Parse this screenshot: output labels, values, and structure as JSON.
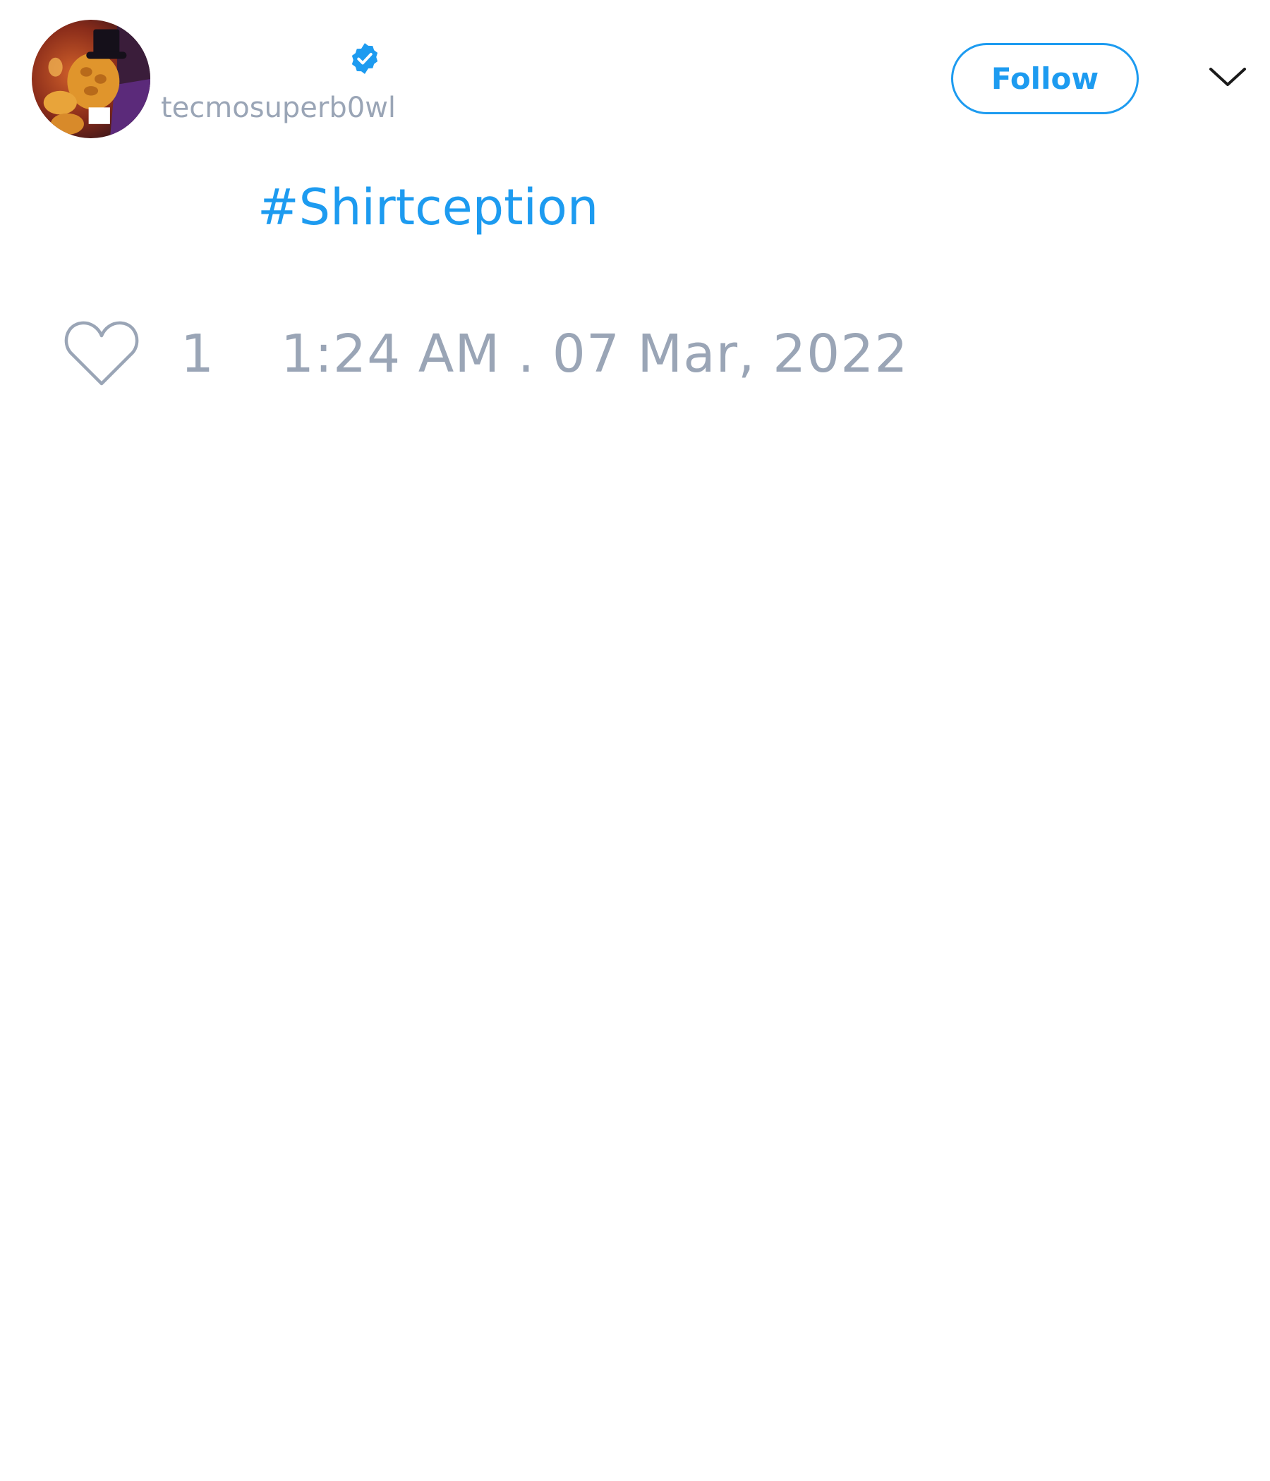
{
  "user": {
    "handle": "tecmosuperb0wl",
    "verified": true,
    "avatar_icon": "avatar-image"
  },
  "header": {
    "follow_label": "Follow",
    "menu_icon": "chevron-down-icon"
  },
  "tweet": {
    "hashtag": "#Shirtception"
  },
  "footer": {
    "like_icon": "heart-icon",
    "like_count": "1",
    "timestamp": "1:24 AM . 07 Mar, 2022"
  },
  "colors": {
    "accent": "#1d9bf0",
    "muted_text": "#9aa5b6",
    "background": "#ffffff"
  }
}
